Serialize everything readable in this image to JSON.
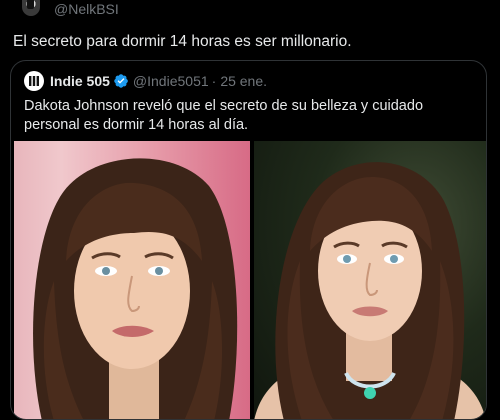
{
  "top": {
    "handle": "@NelkBSI"
  },
  "tweet": {
    "text": "El secreto para dormir 14 horas es ser millonario."
  },
  "quote": {
    "name": "Indie 505",
    "handle": "@Indie5051",
    "separator": "·",
    "date": "25 ene.",
    "text": "Dakota Johnson reveló que el secreto de su belleza y cuidado personal es dormir 14 horas al día."
  },
  "colors": {
    "background": "#000000",
    "text_primary": "#e7e9ea",
    "text_secondary": "#71767b",
    "border": "#2f3336",
    "verified": "#1d9bf0"
  },
  "icons": {
    "verified": "verified-badge-icon",
    "quote_avatar": "indie-505-logo-icon"
  }
}
